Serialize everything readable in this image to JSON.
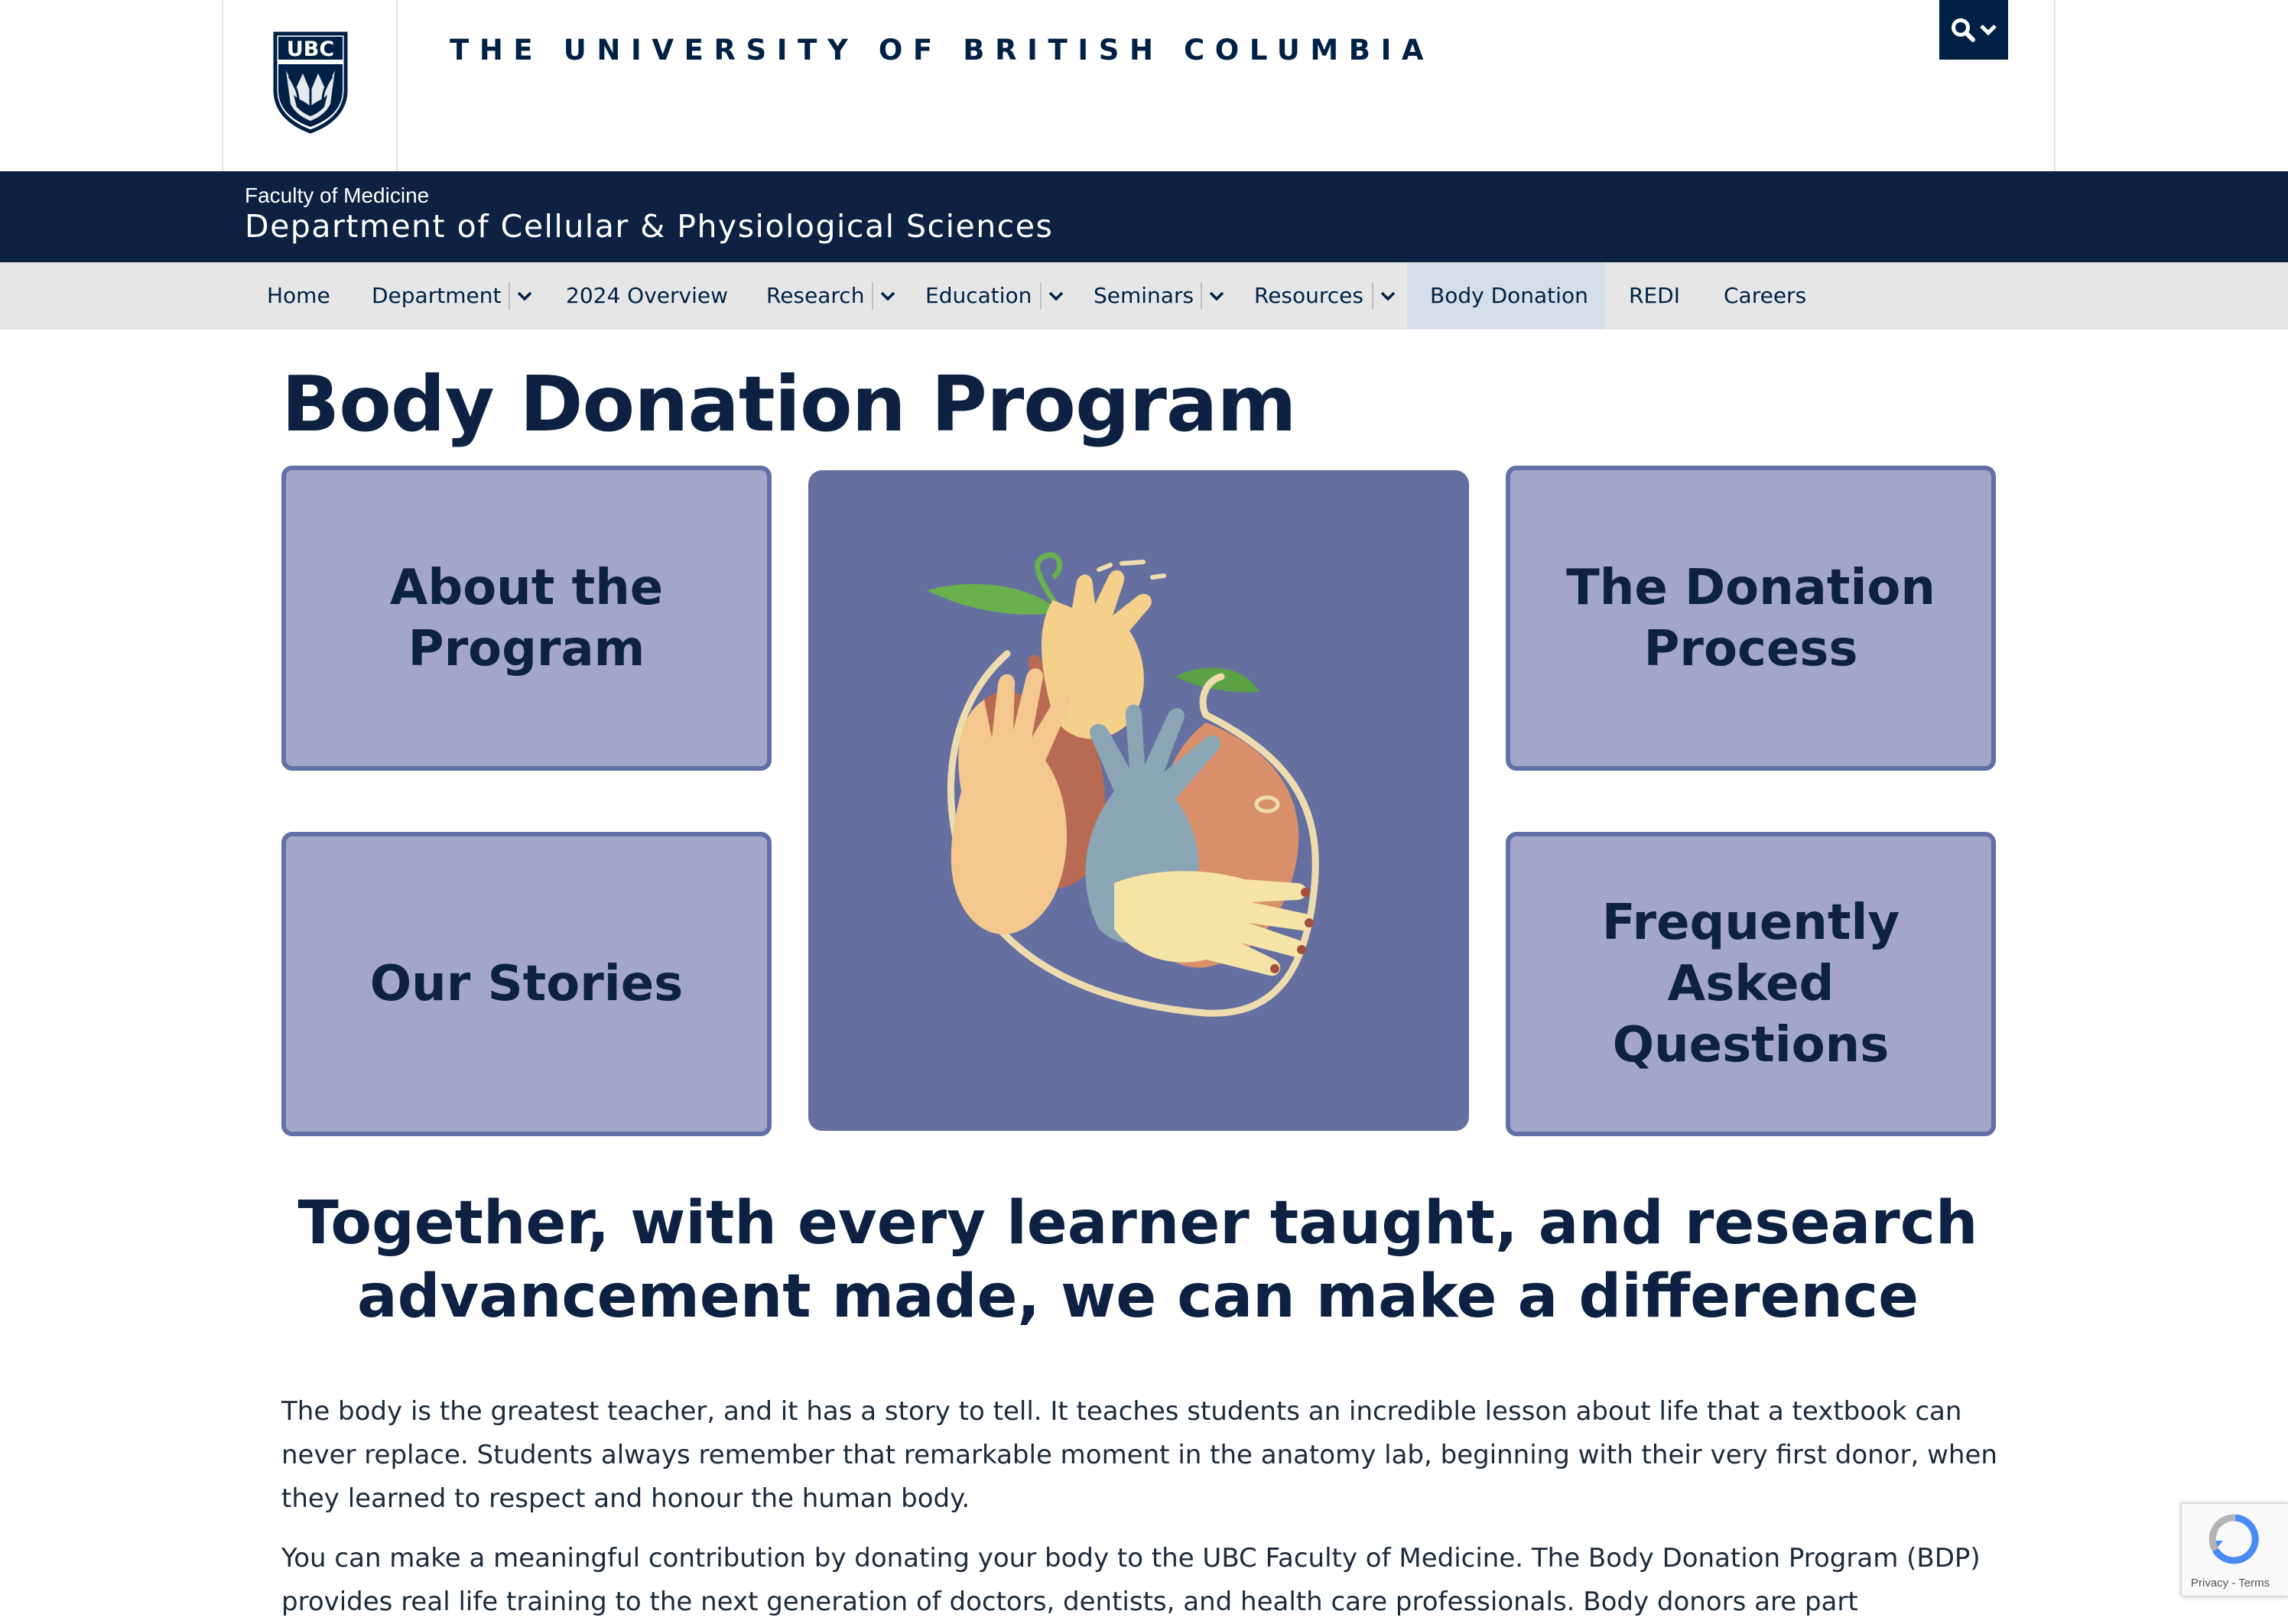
{
  "header": {
    "crest_text": "UBC",
    "university_name": "THE UNIVERSITY OF BRITISH COLUMBIA",
    "search_icon": "search-icon",
    "colors": {
      "navy": "#002145",
      "band": "#0d2143"
    }
  },
  "unit": {
    "faculty": "Faculty of Medicine",
    "department": "Department of Cellular & Physiological Sciences"
  },
  "nav": {
    "items": [
      {
        "label": "Home"
      },
      {
        "label": "Department"
      },
      {
        "label": "2024 Overview"
      },
      {
        "label": "Research"
      },
      {
        "label": "Education"
      },
      {
        "label": "Seminars"
      },
      {
        "label": "Resources"
      },
      {
        "label": "Body Donation"
      },
      {
        "label": "REDI"
      },
      {
        "label": "Careers"
      }
    ],
    "active": "Body Donation"
  },
  "main": {
    "title": "Body Donation Program",
    "tiles": {
      "about": [
        "About the",
        "Program"
      ],
      "process": [
        "The Donation",
        "Process"
      ],
      "stories": [
        "Our Stories"
      ],
      "faq": [
        "Frequently Asked",
        "Questions"
      ]
    },
    "tile_colors": {
      "fill": "#a3a6c8",
      "border": "#6270a6",
      "hero_bg": "#6570a1"
    },
    "tagline": "Together, with every learner taught, and research advancement made, we can make a difference",
    "paragraphs": [
      "The body is the greatest teacher, and it has a story to tell. It teaches students an incredible lesson about life that a textbook can never replace. Students always remember that remarkable moment in the anatomy lab, beginning with their very first donor, when they learned to respect and honour the human body.",
      "You can make a meaningful contribution by donating your body to the UBC Faculty of Medicine. The Body Donation Program (BDP) provides real life training to the next generation of doctors, dentists, and health care professionals. Body donors are part"
    ]
  },
  "recaptcha": {
    "text": "Privacy - Terms"
  }
}
